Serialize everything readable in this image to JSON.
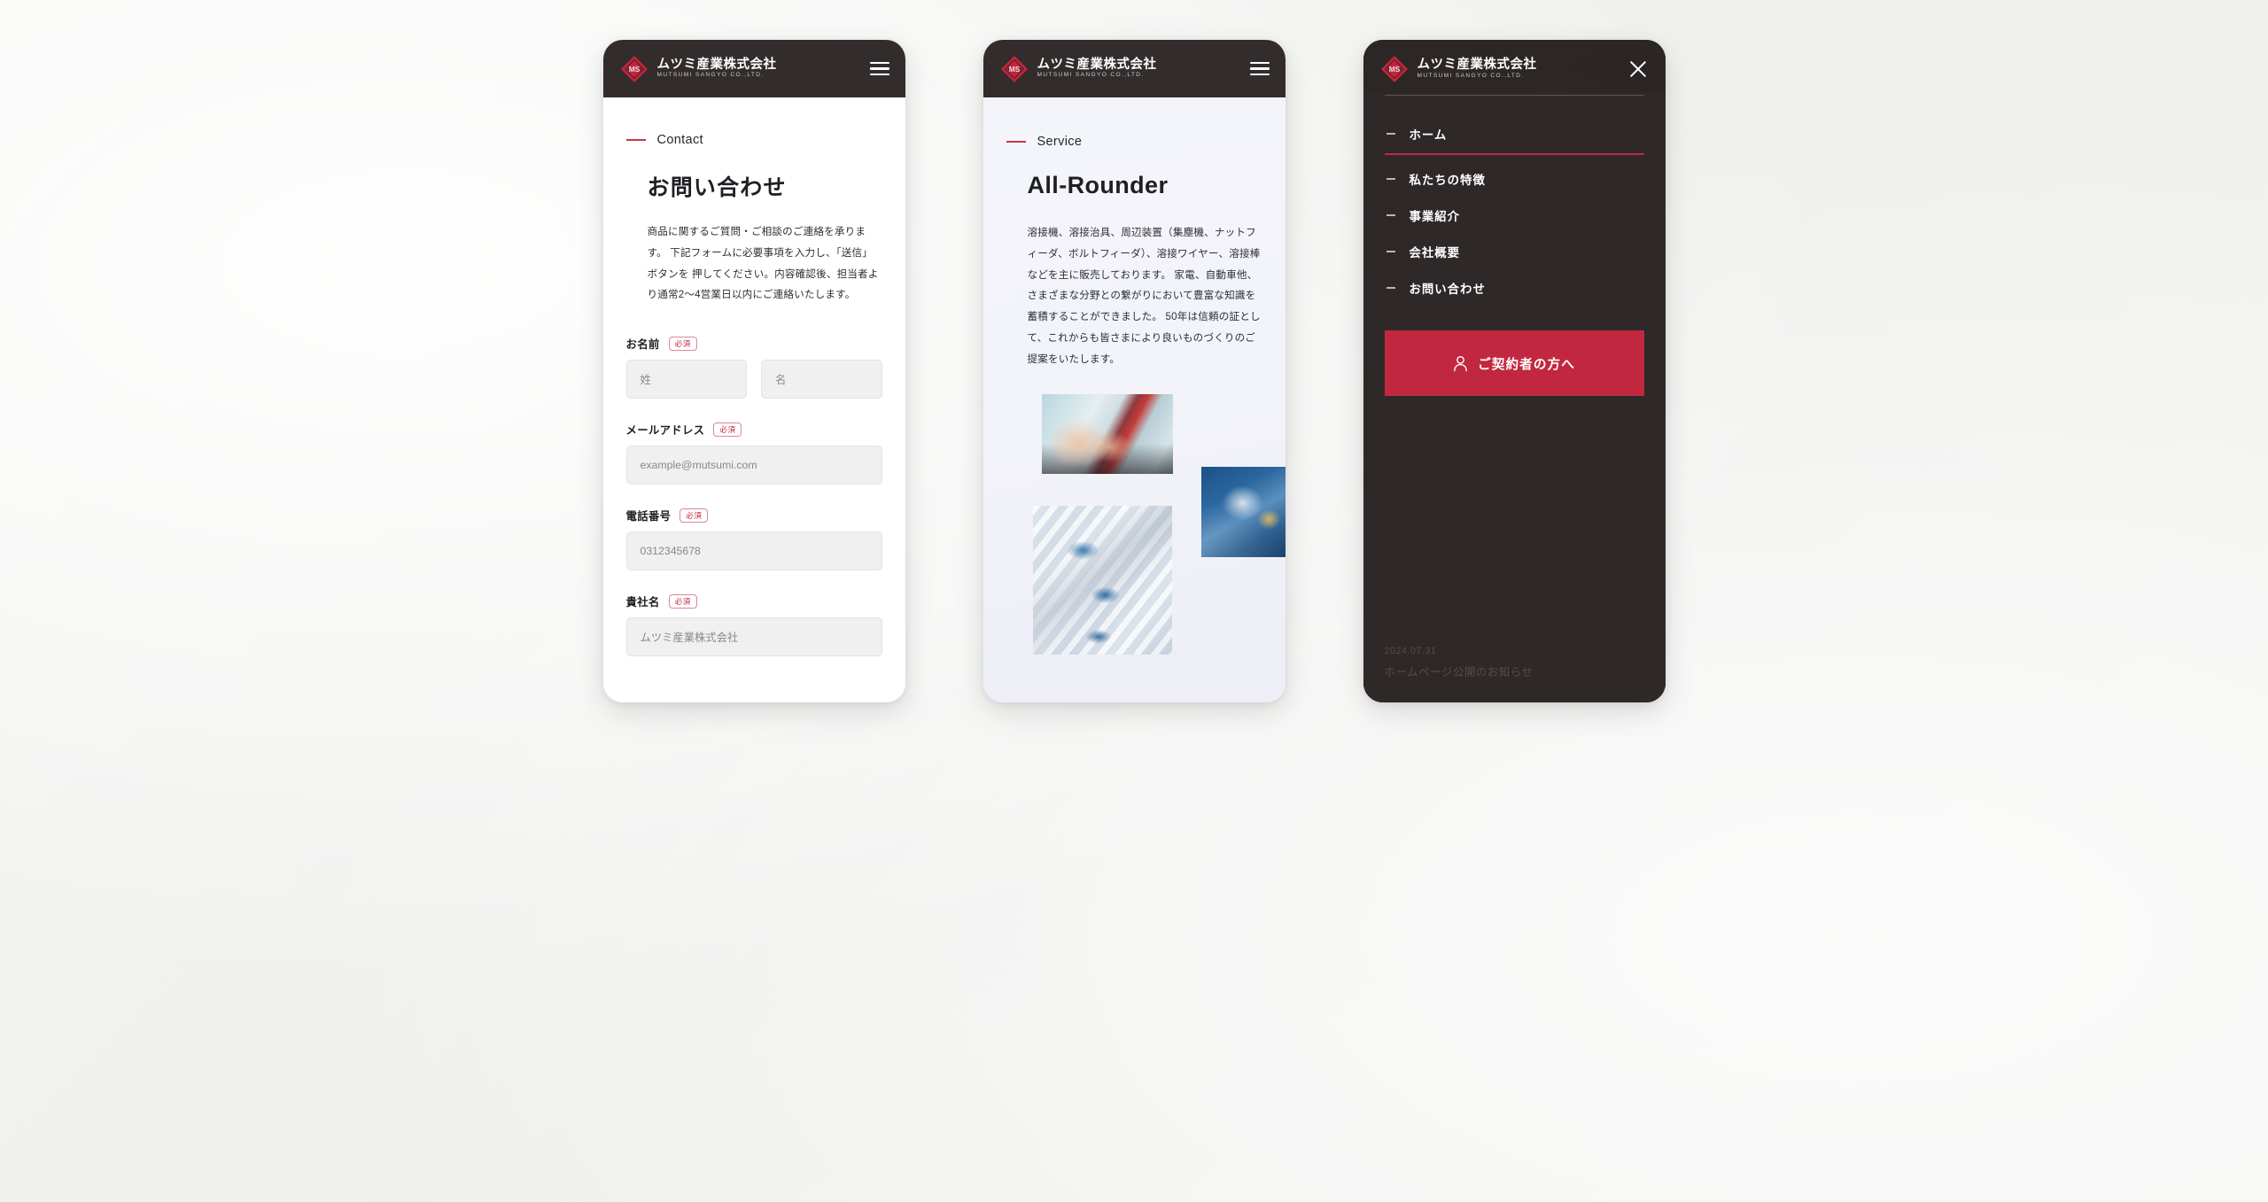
{
  "brand": {
    "name_jp": "ムツミ産業株式会社",
    "name_en": "MUTSUMI SANGYO CO.,LTD.",
    "logo_mark": "mutsumi-diamond-logo",
    "accent_red": "#c1283f",
    "header_dark": "#332c2c"
  },
  "panel_contact": {
    "eyebrow": "Contact",
    "heading": "お問い合わせ",
    "lead": "商品に関するご質問・ご相談のご連絡を承ります。\n下記フォームに必要事項を入力し、「送信」ボタンを 押してください。内容確認後、担当者より通常2〜4営業日以内にご連絡いたします。",
    "required_badge": "必須",
    "fields": [
      {
        "label": "お名前",
        "required": "必須",
        "inputs": [
          {
            "placeholder": "姓",
            "value": ""
          },
          {
            "placeholder": "名",
            "value": ""
          }
        ]
      },
      {
        "label": "メールアドレス",
        "required": "必須",
        "inputs": [
          {
            "placeholder": "example@mutsumi.com",
            "value": ""
          }
        ]
      },
      {
        "label": "電話番号",
        "required": "必須",
        "inputs": [
          {
            "placeholder": "0312345678",
            "value": ""
          }
        ]
      },
      {
        "label": "貴社名",
        "required": "必須",
        "inputs": [
          {
            "placeholder": "ムツミ産業株式会社",
            "value": ""
          }
        ]
      }
    ],
    "menu_icon": "hamburger-icon"
  },
  "panel_service": {
    "eyebrow": "Service",
    "heading": "All-Rounder",
    "paragraph": "溶接機、溶接治具、周辺装置（集塵機、ナットフィーダ、ボルトフィーダ）、溶接ワイヤー、溶接棒などを主に販売しております。\n家電、自動車他、さまざまな分野との繋がりにおいて豊富な知識を蓄積することができました。\n50年は信頼の証として、これからも皆さまにより良いものづくりのご提案をいたします。",
    "menu_icon": "hamburger-icon",
    "images": [
      {
        "name": "handshake-photo",
        "alt": "handshake"
      },
      {
        "name": "robot-chip-photo",
        "alt": "robot arm holding chip"
      },
      {
        "name": "robot-arm-photo",
        "alt": "industrial robot arm"
      }
    ]
  },
  "panel_menu": {
    "close_icon": "close-icon",
    "items": [
      {
        "label": "ホーム",
        "active": true
      },
      {
        "label": "私たちの特徴",
        "active": false
      },
      {
        "label": "事業紹介",
        "active": false
      },
      {
        "label": "会社概要",
        "active": false
      },
      {
        "label": "お問い合わせ",
        "active": false
      }
    ],
    "cta": {
      "label": "ご契約者の方へ",
      "icon": "person-icon",
      "color": "#c1283f"
    },
    "news_ghost": {
      "date": "2024.07.31",
      "title": "ホームページ公開のお知らせ"
    }
  }
}
